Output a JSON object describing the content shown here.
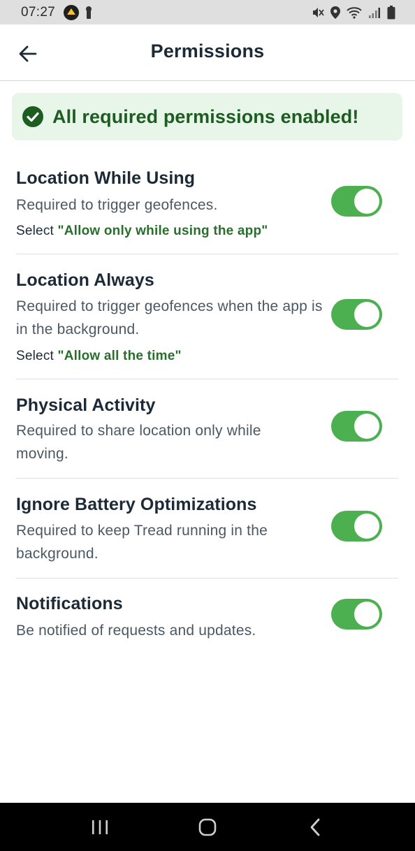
{
  "status_bar": {
    "time": "07:27",
    "left_icons": [
      "app-notification-icon",
      "keyhole-icon"
    ],
    "right_icons": [
      "mute-icon",
      "location-pin-icon",
      "wifi-icon",
      "signal-icon",
      "battery-icon"
    ]
  },
  "app_bar": {
    "title": "Permissions",
    "back_icon": "arrow-left-icon"
  },
  "banner": {
    "text": "All required permissions enabled!",
    "icon": "check-circle-icon",
    "color": "#1e5d22",
    "background": "#e8f5e9"
  },
  "permissions": [
    {
      "title": "Location While Using",
      "description": "Required to trigger geofences.",
      "hint_prefix": "Select ",
      "hint_value": "\"Allow only while using the app\"",
      "enabled": true
    },
    {
      "title": "Location Always",
      "description": "Required to trigger geofences when the app is in the background.",
      "hint_prefix": "Select ",
      "hint_value": "\"Allow all the time\"",
      "enabled": true
    },
    {
      "title": "Physical Activity",
      "description": "Required to share location only while moving.",
      "enabled": true
    },
    {
      "title": "Ignore Battery Optimizations",
      "description": "Required to keep Tread running in the background.",
      "enabled": true
    },
    {
      "title": "Notifications",
      "description": "Be notified of requests and updates.",
      "enabled": true
    }
  ],
  "colors": {
    "toggle_on": "#4caf50",
    "hint_value": "#2a6e2e"
  },
  "nav_bar": {
    "buttons": [
      "recents-icon",
      "home-icon",
      "back-icon"
    ]
  }
}
